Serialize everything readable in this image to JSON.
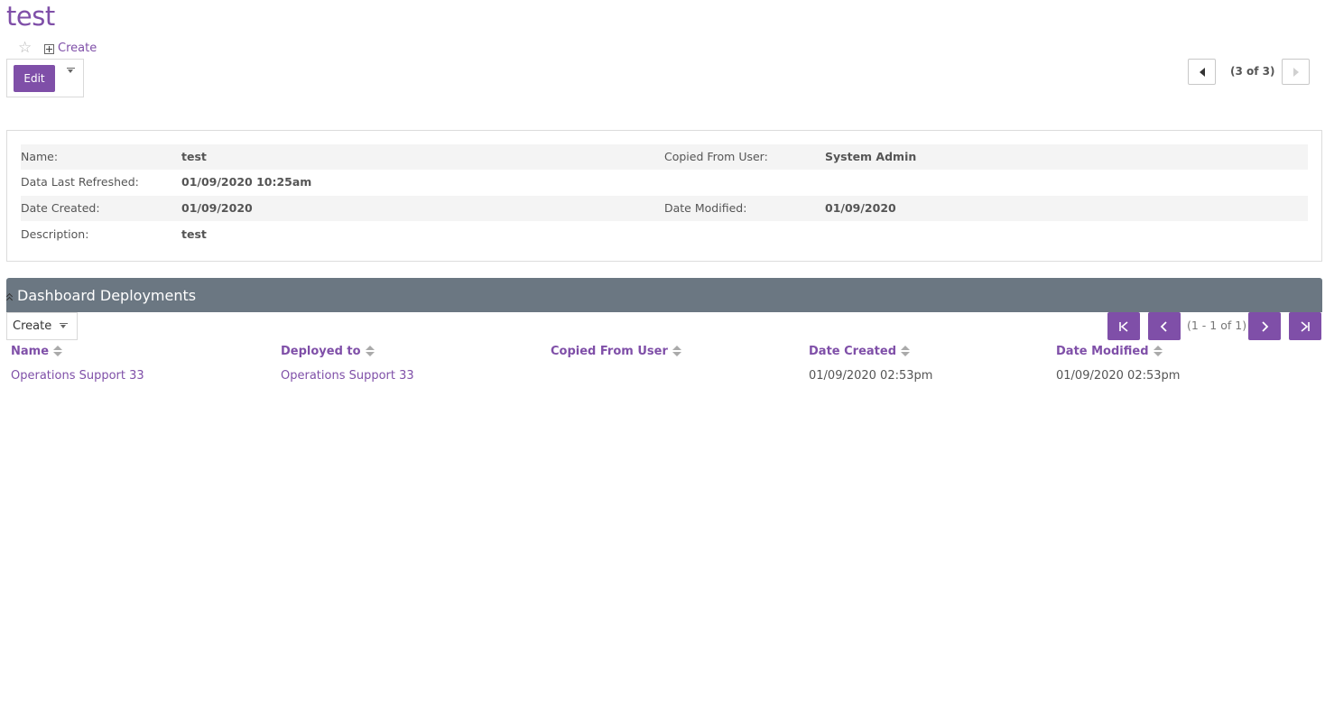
{
  "header": {
    "title": "test",
    "create_label": "Create",
    "edit_label": "Edit",
    "record_position": "(3 of 3)"
  },
  "details": {
    "name_label": "Name:",
    "name_value": "test",
    "copied_from_label": "Copied From User:",
    "copied_from_value": "System Admin",
    "refreshed_label": "Data Last Refreshed:",
    "refreshed_value": "01/09/2020 10:25am",
    "created_label": "Date Created:",
    "created_value": "01/09/2020",
    "modified_label": "Date Modified:",
    "modified_value": "01/09/2020",
    "description_label": "Description:",
    "description_value": "test"
  },
  "deployments": {
    "title": "Dashboard Deployments",
    "create_label": "Create",
    "page_count": "(1 - 1 of 1)",
    "columns": [
      "Name",
      "Deployed to",
      "Copied From User",
      "Date Created",
      "Date Modified"
    ],
    "rows": [
      {
        "name": "Operations Support 33",
        "deployed_to": "Operations Support 33",
        "copied_from": "",
        "date_created": "01/09/2020 02:53pm",
        "date_modified": "01/09/2020 02:53pm"
      }
    ]
  },
  "colors": {
    "accent": "#7f4fa8",
    "section_header": "#6b7782",
    "row_shade": "#f4f4f4"
  },
  "icons": [
    "star-icon",
    "plus-box-icon",
    "dropdown-caret-icon",
    "previous-record-icon",
    "next-record-icon",
    "collapse-icon",
    "first-page-icon",
    "previous-page-icon",
    "next-page-icon",
    "last-page-icon",
    "sort-icon"
  ]
}
